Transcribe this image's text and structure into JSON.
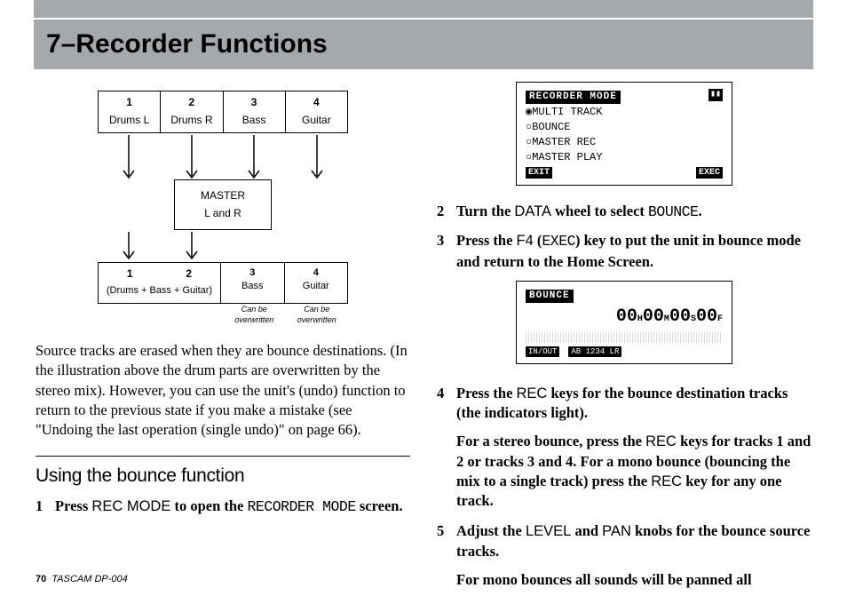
{
  "title": "7–Recorder Functions",
  "diagram": {
    "top": [
      {
        "num": "1",
        "label": "Drums L"
      },
      {
        "num": "2",
        "label": "Drums R"
      },
      {
        "num": "3",
        "label": "Bass"
      },
      {
        "num": "4",
        "label": "Guitar"
      }
    ],
    "master_line1": "MASTER",
    "master_line2": "L and R",
    "bot_big_nums": [
      "1",
      "2"
    ],
    "bot_big_label": "(Drums + Bass + Guitar)",
    "bot_sm": [
      {
        "num": "3",
        "label": "Bass"
      },
      {
        "num": "4",
        "label": "Guitar"
      }
    ],
    "canbe": "Can be overwritten"
  },
  "para1": "Source tracks are erased when they are bounce destinations. (In the illustration above the drum parts are overwritten by the stereo mix). However, you can use the unit's (undo) function to return to the previous state if you make a mistake (see \"Undoing the last operation (single undo)\" on page 66).",
  "subhead": "Using the bounce function",
  "step1_pre": "Press ",
  "step1_btn": "REC MODE",
  "step1_mid": " to open the ",
  "step1_scr": "RECORDER MODE",
  "step1_post": " screen.",
  "lcd1": {
    "title": "RECORDER MODE",
    "items": [
      "MULTI TRACK",
      "BOUNCE",
      "MASTER REC",
      "MASTER PLAY"
    ],
    "exit": "EXIT",
    "exec": "EXEC"
  },
  "step2_pre": "Turn the ",
  "step2_wheel": "DATA",
  "step2_mid": " wheel to select ",
  "step2_val": "BOUNCE",
  "step3_pre": "Press the ",
  "step3_key": "F4",
  "step3_paren_lbl": " (",
  "step3_exec": "EXEC",
  "step3_post": ") key to put the unit in bounce mode and return to the Home Screen.",
  "lcd2": {
    "title": "BOUNCE",
    "time_h": "00",
    "time_m": "00",
    "time_s": "00",
    "time_f": "00",
    "foot1": "IN/OUT",
    "foot2": "AB 1234 LR"
  },
  "step4_pre": "Press the ",
  "step4_rec": "REC",
  "step4_post": " keys for the bounce destination tracks (the indicators light).",
  "step4b_pre": "For a stereo bounce, press the ",
  "step4b_rec": "REC",
  "step4b_mid": " keys for tracks 1 and 2 or tracks 3 and 4. For a mono bounce (bouncing the mix to a single track) press the ",
  "step4b_rec2": "REC",
  "step4b_post": " key for any one track.",
  "step5_pre": "Adjust the ",
  "step5_lvl": "LEVEL",
  "step5_and": " and ",
  "step5_pan": "PAN",
  "step5_post": " knobs for the bounce source tracks.",
  "step5b": "For mono bounces all sounds will be panned all",
  "footer_page": "70",
  "footer_text": "TASCAM  DP-004"
}
